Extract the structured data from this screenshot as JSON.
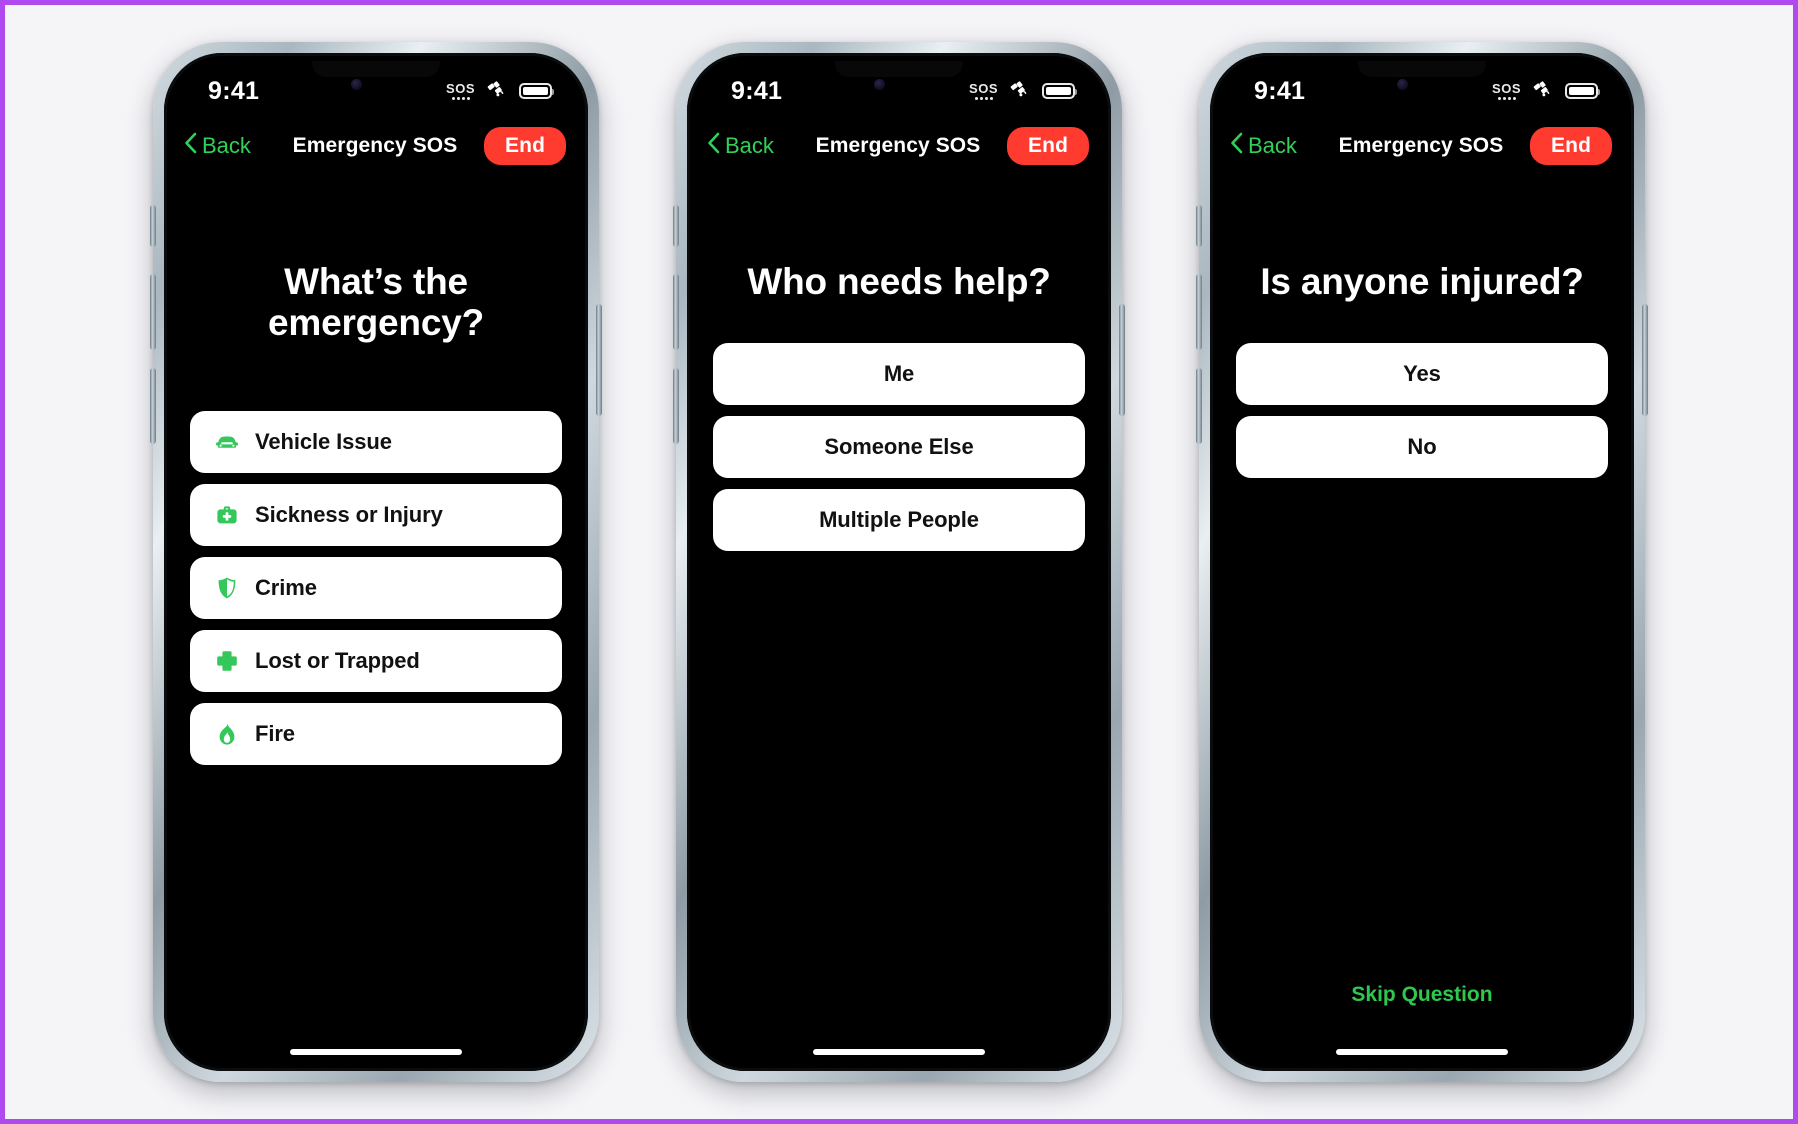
{
  "theme": {
    "page_background": "#f5f4f7",
    "page_border": "#b14aee",
    "accent_green": "#30d158",
    "danger_red": "#ff3b30",
    "screen_background": "#000000",
    "option_background": "#ffffff"
  },
  "status_bar": {
    "time": "9:41",
    "sos_label": "SOS",
    "satellite_icon": "satellite-icon",
    "battery_icon": "battery-full-icon"
  },
  "nav": {
    "back_label": "Back",
    "title": "Emergency SOS",
    "end_label": "End"
  },
  "screens": [
    {
      "id": "what-is-the-emergency",
      "question": "What’s the\nemergency?",
      "options": [
        {
          "label": "Vehicle Issue",
          "icon": "car-icon"
        },
        {
          "label": "Sickness or Injury",
          "icon": "medical-bag-icon"
        },
        {
          "label": "Crime",
          "icon": "shield-icon"
        },
        {
          "label": "Lost or Trapped",
          "icon": "cross-icon"
        },
        {
          "label": "Fire",
          "icon": "flame-icon"
        }
      ],
      "skip_label": null
    },
    {
      "id": "who-needs-help",
      "question": "Who needs help?",
      "options": [
        {
          "label": "Me",
          "icon": null
        },
        {
          "label": "Someone Else",
          "icon": null
        },
        {
          "label": "Multiple People",
          "icon": null
        }
      ],
      "skip_label": null
    },
    {
      "id": "is-anyone-injured",
      "question": "Is anyone injured?",
      "options": [
        {
          "label": "Yes",
          "icon": null
        },
        {
          "label": "No",
          "icon": null
        }
      ],
      "skip_label": "Skip Question"
    }
  ]
}
